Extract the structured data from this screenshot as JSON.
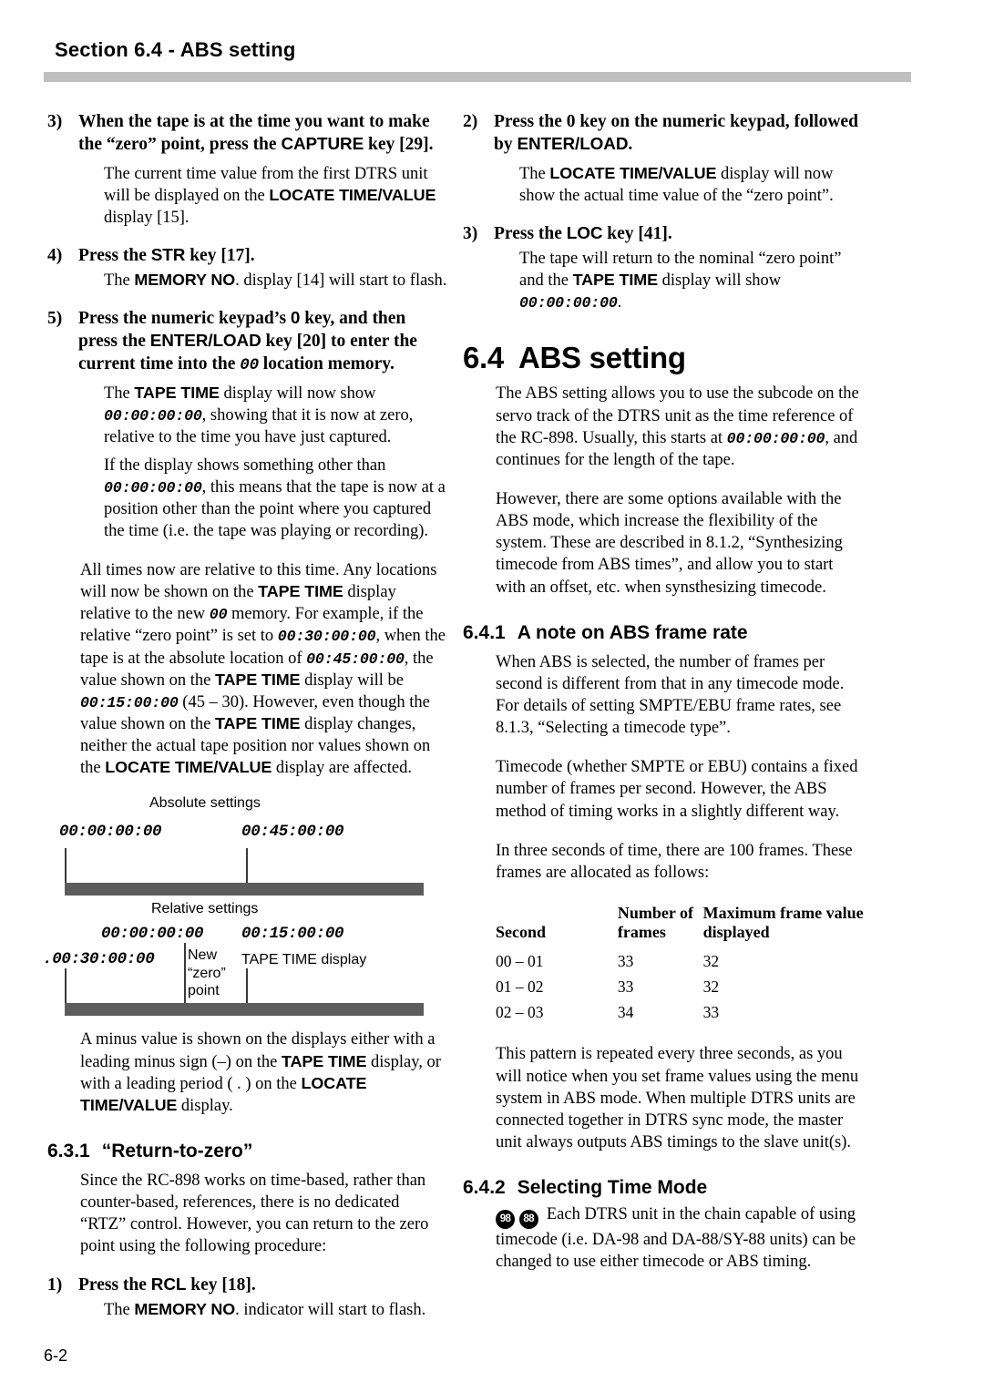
{
  "header": {
    "running_head": "Section 6.4 - ABS setting"
  },
  "footer": {
    "page_number": "6-2"
  },
  "left_column": {
    "step3": {
      "number": "3)",
      "title_a": "When the tape is at the time you want to make the “zero” point, press the ",
      "title_key": "CAPTURE",
      "title_b": " key [29].",
      "body_a": "The current time value from the first DTRS unit will be displayed on the ",
      "body_key": "LOCATE TIME/VALUE",
      "body_b": " display [15]."
    },
    "step4": {
      "number": "4)",
      "title_a": "Press the ",
      "title_key": "STR",
      "title_b": " key [17].",
      "body_a": "The ",
      "body_key": "MEMORY NO",
      "body_b": ". display [14] will start to flash."
    },
    "step5": {
      "number": "5)",
      "title_a": "Press the numeric keypad’s ",
      "title_key1": "0",
      "title_b": " key, and then press the ",
      "title_key2": "ENTER/LOAD",
      "title_c": " key [20] to enter the current time into the ",
      "title_mono": "00",
      "title_d": " location memory.",
      "body1_a": "The ",
      "body1_key": "TAPE TIME",
      "body1_b": " display will now show ",
      "body1_mono": "00:00:00:00",
      "body1_c": ", showing that it is now at zero, relative to the time you have just captured.",
      "body2_a": "If the display shows something other than ",
      "body2_mono": "00:00:00:00",
      "body2_b": ", this means that the tape is now at a position other than the point where you captured the time (i.e. the tape was playing or recording)."
    },
    "relative_para": {
      "a": "All times now are relative to this time. Any locations will now be shown on the ",
      "key1": "TAPE TIME",
      "b": " display relative to the new ",
      "mono1": "00",
      "c": " memory. For example, if the relative “zero point” is set to ",
      "mono2": "00:30:00:00",
      "d": ", when the tape is at the absolute location of ",
      "mono3": "00:45:00:00",
      "e": ", the value shown on the ",
      "key2": "TAPE TIME",
      "f": " display will be ",
      "mono4": "00:15:00:00",
      "g": " (45 – 30). However, even though the value shown on the ",
      "key3": "TAPE TIME",
      "h": " display changes, neither the actual tape position nor values shown on the ",
      "key4": "LOCATE TIME/VALUE",
      "i": " display are affected."
    },
    "diagram": {
      "absolute_caption": "Absolute settings",
      "absolute_t0": "00:00:00:00",
      "absolute_t1": "00:45:00:00",
      "relative_caption": "Relative settings",
      "relative_zero": "00:00:00:00",
      "relative_minus": ".00:30:00:00",
      "relative_t1": "00:15:00:00",
      "new_zero_note": [
        "New",
        "“zero”",
        "point"
      ],
      "tape_time_note": "TAPE TIME display"
    },
    "minus_para": {
      "a": "A minus value is shown on the displays either with a leading minus sign (–) on the ",
      "key1": "TAPE TIME",
      "b": " display, or with a leading period ( . ) on the ",
      "key2": "LOCATE TIME/VALUE",
      "c": " display."
    },
    "section_631": {
      "number": "6.3.1",
      "title": "“Return-to-zero”",
      "body": "Since the RC-898 works on time-based, rather than counter-based, references, there is no dedicated “RTZ” control. However, you can return to the zero point using the following procedure:"
    },
    "step1": {
      "number": "1)",
      "title_a": "Press the ",
      "title_key": "RCL",
      "title_b": " key [18].",
      "body_a": "The ",
      "body_key": "MEMORY NO",
      "body_b": ". indicator will start to flash."
    }
  },
  "right_column": {
    "step2": {
      "number": "2)",
      "title_a": "Press the 0 key on the numeric keypad, followed by ",
      "title_key": "ENTER/LOAD",
      "title_b": ".",
      "body_a": "The ",
      "body_key": "LOCATE TIME/VALUE",
      "body_b": " display will now show the actual time value of the “zero point”."
    },
    "step3": {
      "number": "3)",
      "title_a": "Press the ",
      "title_key": "LOC",
      "title_b": " key [41].",
      "body_a": "The tape will return to the nominal “zero point” and the ",
      "body_key": "TAPE TIME",
      "body_b": " display will show ",
      "body_mono": "00:00:00:00",
      "body_c": "."
    },
    "section_64": {
      "number": "6.4",
      "title": "ABS setting",
      "para1_a": "The ABS setting allows you to use the subcode on the servo track of the DTRS unit as the time reference of the RC-898. Usually, this starts at ",
      "para1_mono": "00:00:00:00",
      "para1_b": ", and continues for the length of the tape.",
      "para2": "However, there are some options available with the ABS mode, which increase the flexibility of the system. These are described in 8.1.2, “Synthesizing timecode from ABS times”, and allow you to start with an offset, etc. when synsthesizing timecode."
    },
    "section_641": {
      "number": "6.4.1",
      "title": "A note on ABS frame rate",
      "para1": "When ABS is selected, the number of frames per second is different from that in any timecode mode. For details of setting SMPTE/EBU frame rates, see 8.1.3, “Selecting a timecode type”.",
      "para2": "Timecode (whether SMPTE or EBU) contains a fixed number of frames per second. However, the ABS method of timing works in a slightly different way.",
      "para3": "In three seconds of time, there are 100 frames. These frames are allocated as follows:",
      "table": {
        "headers": [
          "Second",
          "Number of frames",
          "Maximum frame value displayed"
        ],
        "rows": [
          [
            "00 – 01",
            "33",
            "32"
          ],
          [
            "01 – 02",
            "33",
            "32"
          ],
          [
            "02 – 03",
            "34",
            "33"
          ]
        ]
      },
      "para4": "This pattern is repeated every three seconds, as you will notice when you set frame values using the menu system in ABS mode. When multiple DTRS units are connected together in DTRS sync mode, the master unit always outputs ABS timings to the slave unit(s)."
    },
    "section_642": {
      "number": "6.4.2",
      "title": "Selecting Time Mode",
      "badge1": "98",
      "badge2": "88",
      "body": "Each DTRS unit in the chain capable of using timecode (i.e. DA-98 and DA-88/SY-88 units) can be changed to use either timecode or ABS timing."
    }
  }
}
